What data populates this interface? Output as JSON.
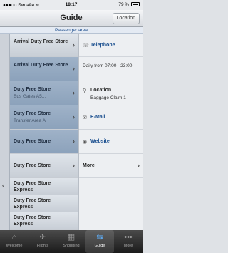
{
  "status_bar": {
    "carrier": "●●●○○ Билайн ≋",
    "time": "18:17",
    "battery": "79 %"
  },
  "nav": {
    "title": "Guide",
    "location_button": "Location"
  },
  "subheader": "Passenger area",
  "stores": [
    {
      "name": "Arrival Duty Free Store",
      "sub": ""
    },
    {
      "name": "Arrival Duty Free Store",
      "sub": ""
    },
    {
      "name": "Duty Free Store",
      "sub": "Bus Gates A5..."
    },
    {
      "name": "Duty Free Store",
      "sub": "Transfer Area A"
    },
    {
      "name": "Duty Free Store",
      "sub": ""
    },
    {
      "name": "Duty Free Store",
      "sub": ""
    },
    {
      "name": "Duty Free Store Express",
      "sub": ""
    },
    {
      "name": "Duty Free Store Express",
      "sub": ""
    },
    {
      "name": "Duty Free Store Express",
      "sub": ""
    }
  ],
  "details": {
    "telephone": "Telephone",
    "hours": "Daily from 07:00 - 23:00",
    "location_label": "Location",
    "location_value": "Baggage Claim 1",
    "email": "E-Mail",
    "website": "Website",
    "more": "More"
  },
  "tabs": [
    {
      "label": "Welcome",
      "icon": "house-icon"
    },
    {
      "label": "Flights",
      "icon": "airplane-icon"
    },
    {
      "label": "Shopping",
      "icon": "shopping-icon"
    },
    {
      "label": "Guide",
      "icon": "signpost-icon"
    },
    {
      "label": "More",
      "icon": "more-dots-icon"
    }
  ],
  "colors": {
    "accent": "#1b4f8f",
    "tab_active": "#5fb2ff"
  }
}
